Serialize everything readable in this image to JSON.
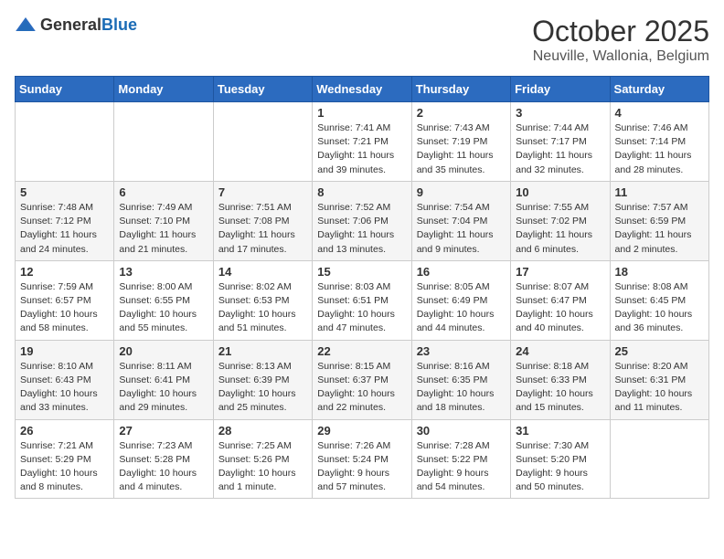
{
  "header": {
    "logo_general": "General",
    "logo_blue": "Blue",
    "month": "October 2025",
    "location": "Neuville, Wallonia, Belgium"
  },
  "days_of_week": [
    "Sunday",
    "Monday",
    "Tuesday",
    "Wednesday",
    "Thursday",
    "Friday",
    "Saturday"
  ],
  "weeks": [
    [
      {
        "day": "",
        "info": ""
      },
      {
        "day": "",
        "info": ""
      },
      {
        "day": "",
        "info": ""
      },
      {
        "day": "1",
        "info": "Sunrise: 7:41 AM\nSunset: 7:21 PM\nDaylight: 11 hours and 39 minutes."
      },
      {
        "day": "2",
        "info": "Sunrise: 7:43 AM\nSunset: 7:19 PM\nDaylight: 11 hours and 35 minutes."
      },
      {
        "day": "3",
        "info": "Sunrise: 7:44 AM\nSunset: 7:17 PM\nDaylight: 11 hours and 32 minutes."
      },
      {
        "day": "4",
        "info": "Sunrise: 7:46 AM\nSunset: 7:14 PM\nDaylight: 11 hours and 28 minutes."
      }
    ],
    [
      {
        "day": "5",
        "info": "Sunrise: 7:48 AM\nSunset: 7:12 PM\nDaylight: 11 hours and 24 minutes."
      },
      {
        "day": "6",
        "info": "Sunrise: 7:49 AM\nSunset: 7:10 PM\nDaylight: 11 hours and 21 minutes."
      },
      {
        "day": "7",
        "info": "Sunrise: 7:51 AM\nSunset: 7:08 PM\nDaylight: 11 hours and 17 minutes."
      },
      {
        "day": "8",
        "info": "Sunrise: 7:52 AM\nSunset: 7:06 PM\nDaylight: 11 hours and 13 minutes."
      },
      {
        "day": "9",
        "info": "Sunrise: 7:54 AM\nSunset: 7:04 PM\nDaylight: 11 hours and 9 minutes."
      },
      {
        "day": "10",
        "info": "Sunrise: 7:55 AM\nSunset: 7:02 PM\nDaylight: 11 hours and 6 minutes."
      },
      {
        "day": "11",
        "info": "Sunrise: 7:57 AM\nSunset: 6:59 PM\nDaylight: 11 hours and 2 minutes."
      }
    ],
    [
      {
        "day": "12",
        "info": "Sunrise: 7:59 AM\nSunset: 6:57 PM\nDaylight: 10 hours and 58 minutes."
      },
      {
        "day": "13",
        "info": "Sunrise: 8:00 AM\nSunset: 6:55 PM\nDaylight: 10 hours and 55 minutes."
      },
      {
        "day": "14",
        "info": "Sunrise: 8:02 AM\nSunset: 6:53 PM\nDaylight: 10 hours and 51 minutes."
      },
      {
        "day": "15",
        "info": "Sunrise: 8:03 AM\nSunset: 6:51 PM\nDaylight: 10 hours and 47 minutes."
      },
      {
        "day": "16",
        "info": "Sunrise: 8:05 AM\nSunset: 6:49 PM\nDaylight: 10 hours and 44 minutes."
      },
      {
        "day": "17",
        "info": "Sunrise: 8:07 AM\nSunset: 6:47 PM\nDaylight: 10 hours and 40 minutes."
      },
      {
        "day": "18",
        "info": "Sunrise: 8:08 AM\nSunset: 6:45 PM\nDaylight: 10 hours and 36 minutes."
      }
    ],
    [
      {
        "day": "19",
        "info": "Sunrise: 8:10 AM\nSunset: 6:43 PM\nDaylight: 10 hours and 33 minutes."
      },
      {
        "day": "20",
        "info": "Sunrise: 8:11 AM\nSunset: 6:41 PM\nDaylight: 10 hours and 29 minutes."
      },
      {
        "day": "21",
        "info": "Sunrise: 8:13 AM\nSunset: 6:39 PM\nDaylight: 10 hours and 25 minutes."
      },
      {
        "day": "22",
        "info": "Sunrise: 8:15 AM\nSunset: 6:37 PM\nDaylight: 10 hours and 22 minutes."
      },
      {
        "day": "23",
        "info": "Sunrise: 8:16 AM\nSunset: 6:35 PM\nDaylight: 10 hours and 18 minutes."
      },
      {
        "day": "24",
        "info": "Sunrise: 8:18 AM\nSunset: 6:33 PM\nDaylight: 10 hours and 15 minutes."
      },
      {
        "day": "25",
        "info": "Sunrise: 8:20 AM\nSunset: 6:31 PM\nDaylight: 10 hours and 11 minutes."
      }
    ],
    [
      {
        "day": "26",
        "info": "Sunrise: 7:21 AM\nSunset: 5:29 PM\nDaylight: 10 hours and 8 minutes."
      },
      {
        "day": "27",
        "info": "Sunrise: 7:23 AM\nSunset: 5:28 PM\nDaylight: 10 hours and 4 minutes."
      },
      {
        "day": "28",
        "info": "Sunrise: 7:25 AM\nSunset: 5:26 PM\nDaylight: 10 hours and 1 minute."
      },
      {
        "day": "29",
        "info": "Sunrise: 7:26 AM\nSunset: 5:24 PM\nDaylight: 9 hours and 57 minutes."
      },
      {
        "day": "30",
        "info": "Sunrise: 7:28 AM\nSunset: 5:22 PM\nDaylight: 9 hours and 54 minutes."
      },
      {
        "day": "31",
        "info": "Sunrise: 7:30 AM\nSunset: 5:20 PM\nDaylight: 9 hours and 50 minutes."
      },
      {
        "day": "",
        "info": ""
      }
    ]
  ]
}
